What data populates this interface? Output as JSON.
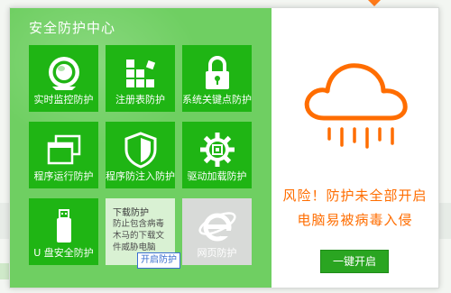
{
  "panel_title": "安全防护中心",
  "tiles": [
    {
      "label": "实时监控防护",
      "icon": "monitor-eye-icon",
      "state": "enabled"
    },
    {
      "label": "注册表防护",
      "icon": "registry-blocks-icon",
      "state": "enabled"
    },
    {
      "label": "系统关键点防护",
      "icon": "lock-icon",
      "state": "enabled"
    },
    {
      "label": "程序运行防护",
      "icon": "windows-icon",
      "state": "enabled"
    },
    {
      "label": "程序防注入防护",
      "icon": "shield-icon",
      "state": "enabled"
    },
    {
      "label": "驱动加载防护",
      "icon": "gear-icon",
      "state": "enabled"
    },
    {
      "label": "U 盘安全防护",
      "icon": "usb-drive-icon",
      "state": "enabled"
    },
    {
      "label": "网页防护",
      "icon": "browser-e-icon",
      "state": "disabled"
    }
  ],
  "download_protection": {
    "title": "下载防护",
    "description": "防止包含病毒木马的下载文件威胁电脑",
    "button_label": "开启防护"
  },
  "status": {
    "icon": "rain-cloud-icon",
    "line1": "风险！防护未全部开启",
    "line2": "电脑易被病毒入侵"
  },
  "one_click_button": "一键开启",
  "colors": {
    "tile_green": "#1fb514",
    "panel_bg_green": "#6fcf62",
    "warning_orange": "#ff6d00",
    "disabled_gray": "#d8dad8",
    "link_blue": "#3a6fd0"
  }
}
